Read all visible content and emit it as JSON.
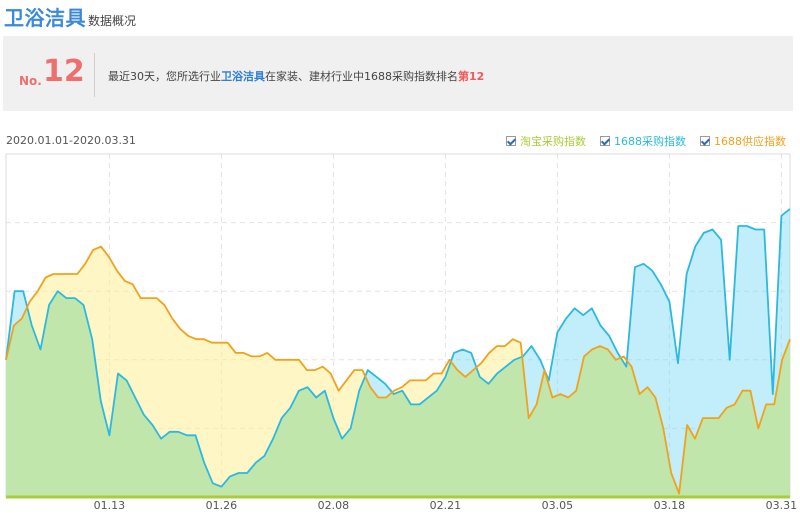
{
  "header": {
    "title": "卫浴洁具",
    "subtitle": "数据概况"
  },
  "rank": {
    "prefix": "No.",
    "value": "12",
    "text_before": "最近30天，您所选行业",
    "category": "卫浴洁具",
    "text_middle": "在家装、建材行业中1688采购指数排名",
    "rank_label": "第12"
  },
  "colors": {
    "taobao": "#a9cc39",
    "purchase": "#2bb9e0",
    "supply": "#f0a21d",
    "rank": "#ef6f6f",
    "title": "#3c8ad6"
  },
  "chart_data": {
    "type": "area",
    "date_range": "2020.01.01-2020.03.31",
    "legend": [
      {
        "name": "淘宝采购指数",
        "color": "#a9cc39",
        "checked": true
      },
      {
        "name": "1688采购指数",
        "color": "#2bb9e0",
        "checked": true
      },
      {
        "name": "1688供应指数",
        "color": "#f0a21d",
        "checked": true
      }
    ],
    "x_ticks": [
      "01.13",
      "01.26",
      "02.08",
      "02.21",
      "03.05",
      "03.18",
      "03.31"
    ],
    "x_tick_positions": [
      12,
      25,
      38,
      51,
      64,
      77,
      90
    ],
    "x_range": [
      0,
      91
    ],
    "y_range": [
      0,
      100
    ],
    "grid": true,
    "series": [
      {
        "name": "淘宝采购指数",
        "color": "#a9cc39",
        "values": [
          0,
          0,
          0,
          0,
          0,
          0,
          0,
          0,
          0,
          0,
          0,
          0,
          0,
          0,
          0,
          0,
          0,
          0,
          0,
          0,
          0,
          0,
          0,
          0,
          0,
          0,
          0,
          0,
          0,
          0,
          0,
          0,
          0,
          0,
          0,
          0,
          0,
          0,
          0,
          0,
          0,
          0,
          0,
          0,
          0,
          0,
          0,
          0,
          0,
          0,
          0,
          0,
          0,
          0,
          0,
          0,
          0,
          0,
          0,
          0,
          0,
          0,
          0,
          0,
          0,
          0,
          0,
          0,
          0,
          0,
          0,
          0,
          0,
          0,
          0,
          0,
          0,
          0,
          0,
          0,
          0,
          0,
          0,
          0,
          0,
          0,
          0,
          0,
          0,
          0,
          0
        ]
      },
      {
        "name": "1688采购指数",
        "color": "#2bb9e0",
        "values": [
          40,
          60,
          60,
          50,
          43,
          56,
          60,
          58,
          58,
          56,
          46,
          28,
          18,
          36,
          34,
          29,
          24,
          21,
          17,
          19,
          19,
          18,
          18,
          10,
          4,
          3,
          6,
          7,
          7,
          10,
          12,
          17,
          23,
          26,
          31,
          32,
          29,
          31,
          23,
          17,
          20,
          31,
          37,
          35,
          33,
          30,
          31,
          27,
          27,
          29,
          31,
          35,
          42,
          43,
          42,
          35,
          33,
          36,
          38,
          40,
          41,
          44,
          40,
          34,
          48,
          52,
          55,
          53,
          55,
          50,
          47,
          42,
          38,
          67,
          68,
          66,
          62,
          57,
          39,
          65,
          73,
          77,
          78,
          75,
          40,
          79,
          79,
          78,
          78,
          30,
          82,
          84
        ]
      },
      {
        "name": "1688供应指数",
        "color": "#f0a21d",
        "values": [
          40,
          50,
          52,
          57,
          60,
          64,
          65,
          65,
          65,
          65,
          68,
          72,
          73,
          70,
          66,
          63,
          62,
          58,
          58,
          58,
          56,
          52,
          49,
          47,
          46,
          46,
          45,
          45,
          45,
          42,
          42,
          41,
          41,
          42,
          40,
          40,
          40,
          40,
          37,
          37,
          38,
          36,
          31,
          34,
          37,
          37,
          32,
          29,
          29,
          31,
          32,
          34,
          34,
          34,
          36,
          36,
          40,
          37,
          35,
          37,
          39,
          42,
          44,
          44,
          46,
          45,
          23,
          27,
          37,
          29,
          30,
          29,
          31,
          41,
          43,
          44,
          43,
          40,
          41,
          38,
          30,
          32,
          29,
          20,
          7,
          1,
          21,
          17,
          23,
          23,
          23,
          26,
          27,
          31,
          31,
          20,
          27,
          27,
          40,
          46
        ]
      }
    ]
  }
}
